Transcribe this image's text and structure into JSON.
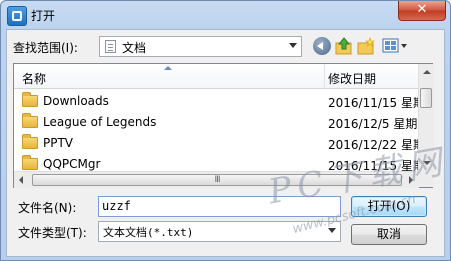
{
  "window": {
    "title": "打开",
    "close_label": "✕"
  },
  "lookin": {
    "label": "查找范围(I):",
    "value": "文档"
  },
  "list": {
    "headers": {
      "name": "名称",
      "date": "修改日期"
    },
    "items": [
      {
        "name": "Downloads",
        "date": "2016/11/15 星期"
      },
      {
        "name": "League of Legends",
        "date": "2016/12/5 星期"
      },
      {
        "name": "PPTV",
        "date": "2016/12/22 星期"
      },
      {
        "name": "QQPCMgr",
        "date": "2016/11/15 星期"
      }
    ],
    "hscroll_grip": "III"
  },
  "filename": {
    "label": "文件名(N):",
    "value": "uzzf"
  },
  "filetype": {
    "label": "文件类型(T):",
    "value": "文本文档(*.txt)"
  },
  "buttons": {
    "open": "打开(O)",
    "cancel": "取消"
  },
  "watermark": {
    "main": "PC下载网",
    "url": "www.pcsoft.com.cn"
  },
  "colors": {
    "title_bg": "#bcd3ee",
    "close_red": "#c03a22",
    "panel": "#f0f0f0",
    "folder": "#e7b43c"
  }
}
